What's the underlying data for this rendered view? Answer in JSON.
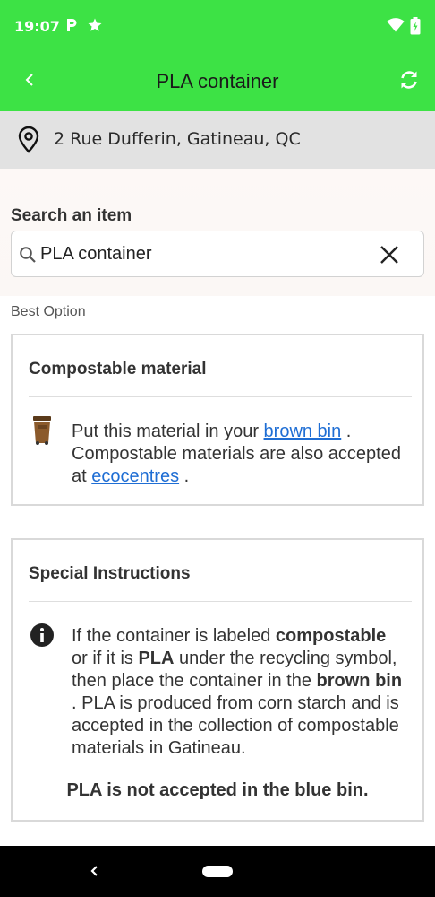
{
  "status_bar": {
    "time": "19:07",
    "icons": [
      "parking-p-icon",
      "star-icon",
      "wifi-icon",
      "battery-icon"
    ]
  },
  "app_bar": {
    "title": "PLA container",
    "back_icon": "chevron-left-icon",
    "refresh_icon": "refresh-icon"
  },
  "location": {
    "address": "2 Rue Dufferin, Gatineau, QC",
    "icon": "location-pin-icon"
  },
  "search": {
    "label": "Search an item",
    "value": "PLA container",
    "placeholder": "",
    "clear_icon": "close-icon"
  },
  "best_option": {
    "label": "Best Option",
    "title": "Compostable material",
    "icon": "brown-bin-icon",
    "text_before_link1": "Put this material in your ",
    "link1": "brown bin",
    "text_after_link1": " . Compostable materials are also accepted at ",
    "link2": "ecocentres",
    "text_after_link2": " ."
  },
  "special_instructions": {
    "title": "Special Instructions",
    "icon": "info-icon",
    "p1": "If the container is labeled ",
    "b1": "compostable",
    "p2": " or if it is ",
    "b2": "PLA",
    "p3": " under the recycling symbol, then place the container in the ",
    "b3": "brown bin",
    "p4": " . PLA is produced from corn starch and is accepted in the collection of compostable materials in Gatineau.",
    "warning": "PLA is not accepted in the blue bin."
  },
  "colors": {
    "accent": "#3de245",
    "link": "#1f6ed4",
    "bin": "#8b5a2b"
  }
}
